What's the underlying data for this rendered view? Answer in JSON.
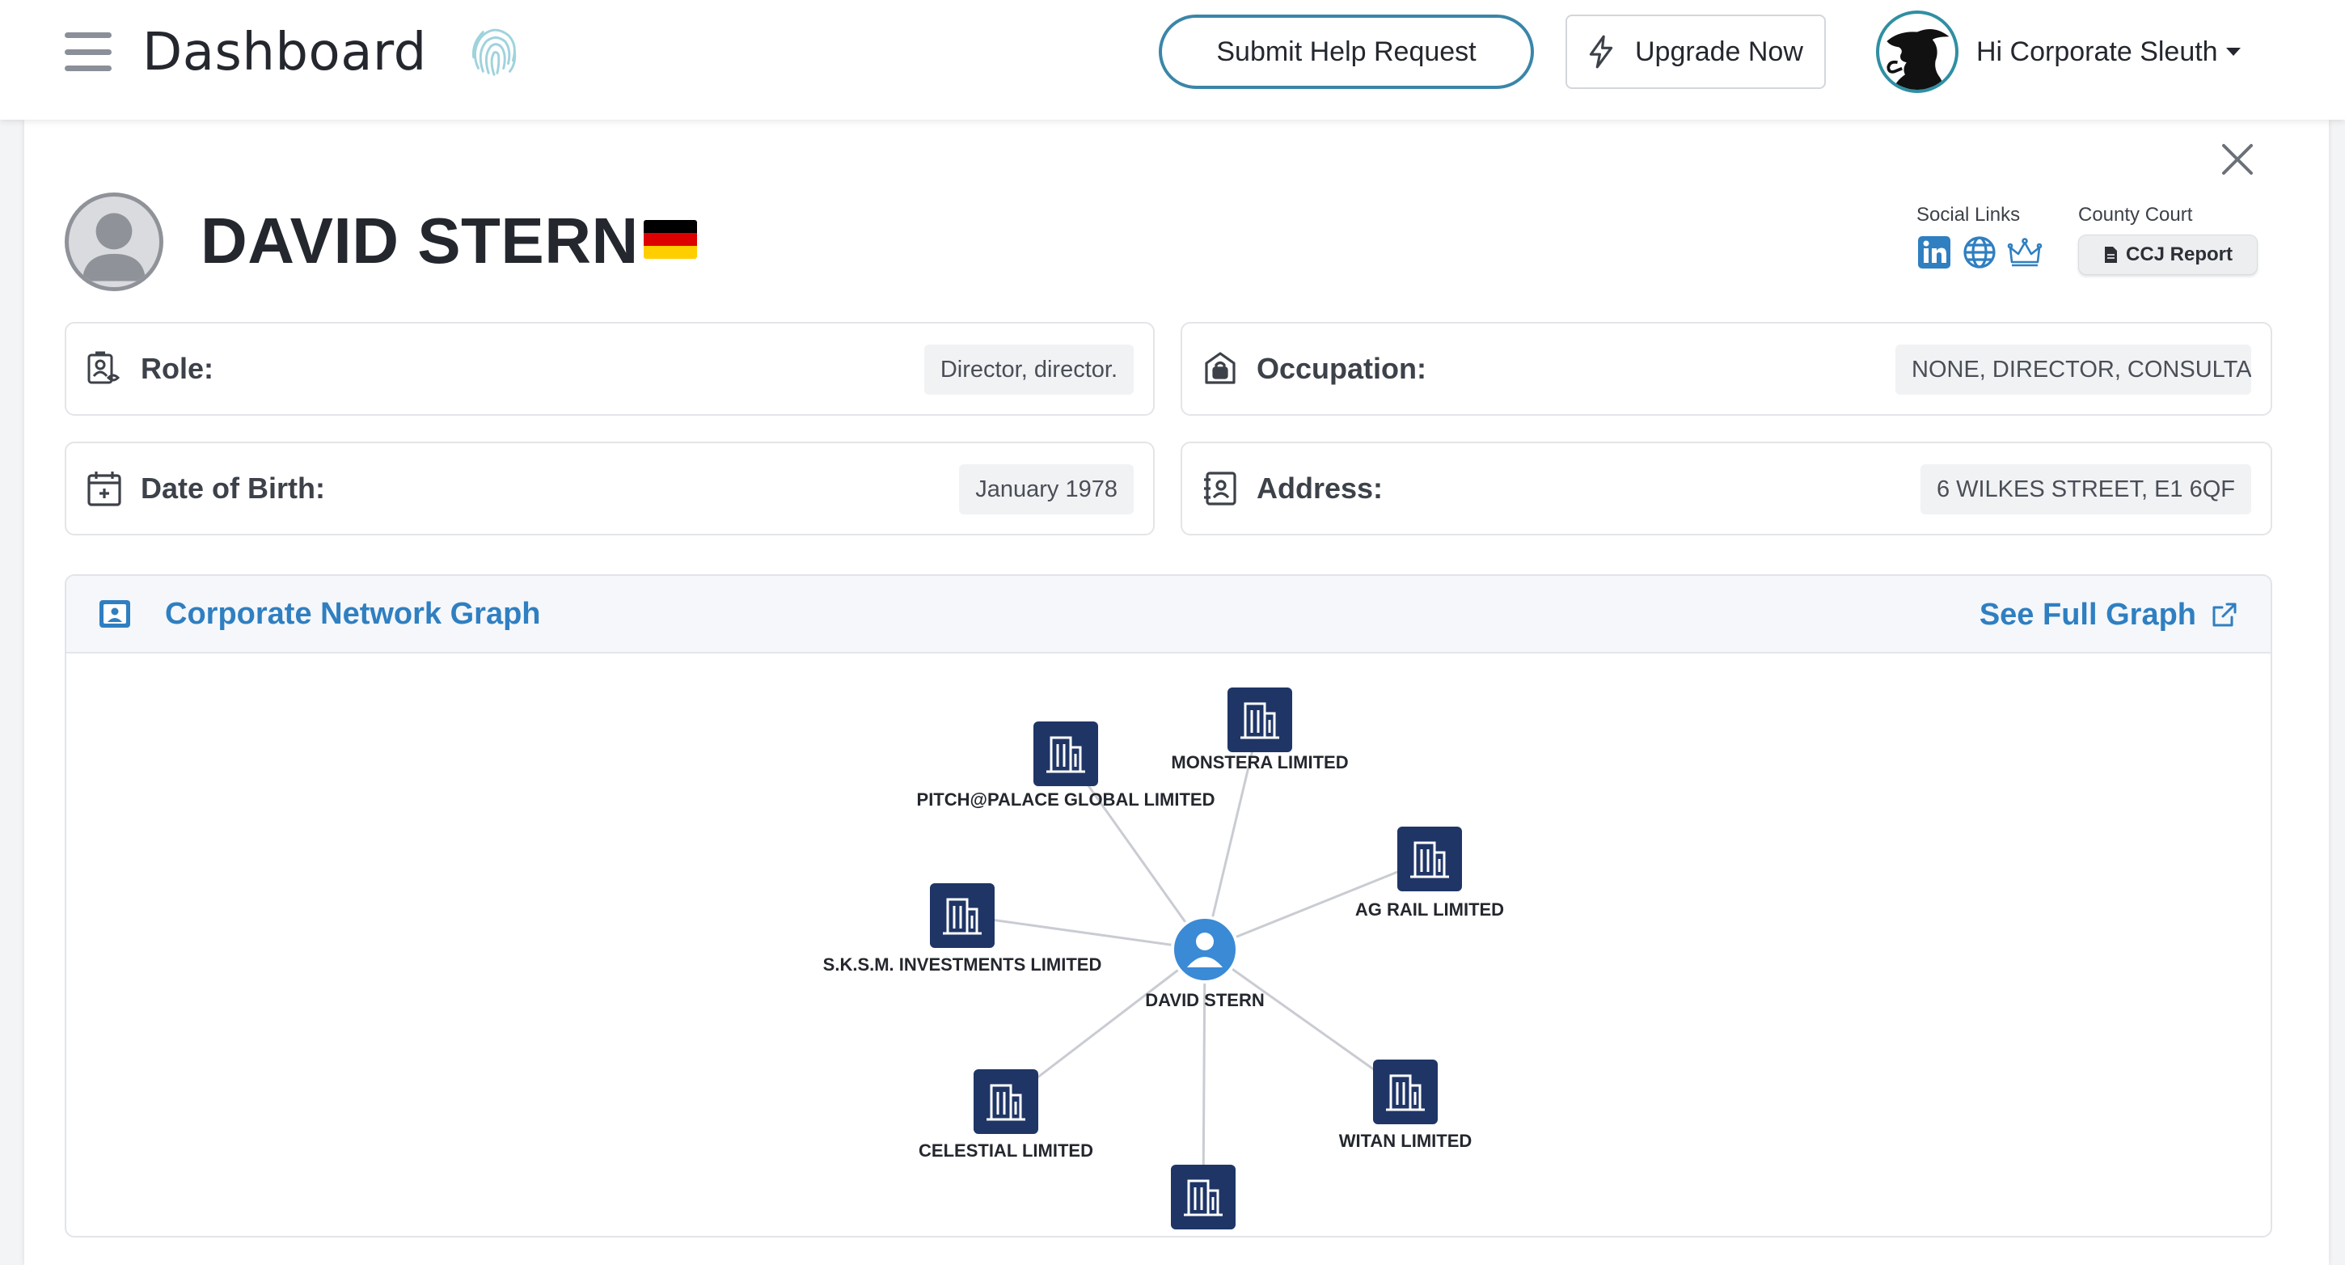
{
  "header": {
    "title": "Dashboard",
    "help_button": "Submit Help Request",
    "upgrade_button": "Upgrade Now",
    "user_greeting": "Hi Corporate Sleuth"
  },
  "person": {
    "name": "DAVID STERN",
    "flag_colors": [
      "#000000",
      "#dd0000",
      "#ffce00"
    ]
  },
  "links": {
    "social_label": "Social Links",
    "social_icons": [
      "linkedin-icon",
      "globe-icon",
      "crown-icon"
    ],
    "court_label": "County Court",
    "ccj_button": "CCJ Report"
  },
  "details": {
    "role_label": "Role:",
    "role_value": "Director, director.",
    "occupation_label": "Occupation:",
    "occupation_value": "NONE, DIRECTOR, CONSULTANT",
    "dob_label": "Date of Birth:",
    "dob_value": "January 1978",
    "address_label": "Address:",
    "address_value": "6 WILKES STREET, E1 6QF"
  },
  "graph": {
    "title": "Corporate Network Graph",
    "see_full": "See Full Graph",
    "center": "DAVID STERN",
    "companies": [
      "MONSTERA LIMITED",
      "PITCH@PALACE GLOBAL LIMITED",
      "AG RAIL LIMITED",
      "S.K.S.M. INVESTMENTS LIMITED",
      "CELESTIAL LIMITED",
      "WITAN LIMITED",
      ""
    ]
  },
  "colors": {
    "accent": "#2f7fc1",
    "node_dark": "#1f3566",
    "person_node": "#3a8ad6",
    "edge": "#c9ccd2"
  }
}
